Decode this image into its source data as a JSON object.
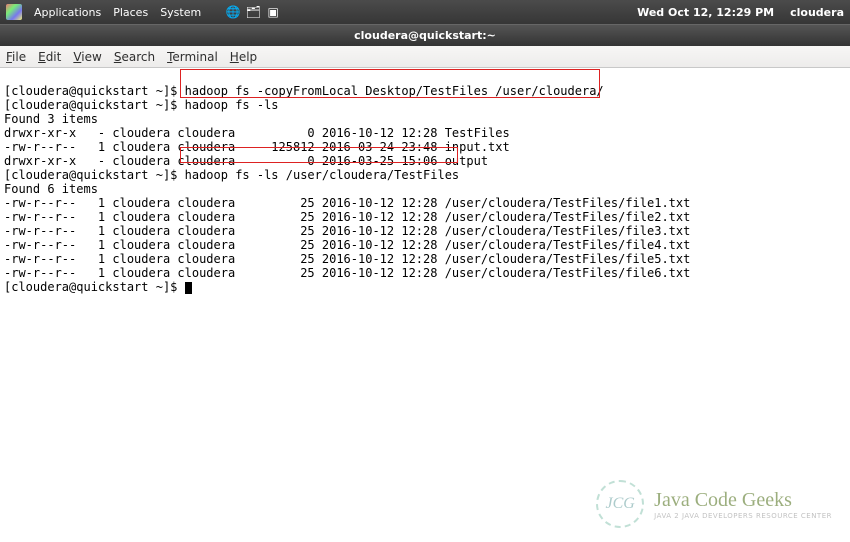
{
  "panel": {
    "menus": [
      "Applications",
      "Places",
      "System"
    ],
    "clock": "Wed Oct 12, 12:29 PM",
    "user": "cloudera"
  },
  "window": {
    "title": "cloudera@quickstart:~"
  },
  "menubar": {
    "file": "File",
    "edit": "Edit",
    "view": "View",
    "search": "Search",
    "terminal": "Terminal",
    "help": "Help"
  },
  "prompt": "[cloudera@quickstart ~]$ ",
  "lines": {
    "l0": "[cloudera@quickstart ~]$ hadoop fs -copyFromLocal Desktop/TestFiles /user/cloudera/",
    "l1": "[cloudera@quickstart ~]$ hadoop fs -ls",
    "l2": "Found 3 items",
    "l3": "drwxr-xr-x   - cloudera cloudera          0 2016-10-12 12:28 TestFiles",
    "l4": "-rw-r--r--   1 cloudera cloudera     125812 2016-03-24 23:48 input.txt",
    "l5": "drwxr-xr-x   - cloudera cloudera          0 2016-03-25 15:06 output",
    "l6": "[cloudera@quickstart ~]$ hadoop fs -ls /user/cloudera/TestFiles",
    "l7": "Found 6 items",
    "l8": "-rw-r--r--   1 cloudera cloudera         25 2016-10-12 12:28 /user/cloudera/TestFiles/file1.txt",
    "l9": "-rw-r--r--   1 cloudera cloudera         25 2016-10-12 12:28 /user/cloudera/TestFiles/file2.txt",
    "l10": "-rw-r--r--   1 cloudera cloudera         25 2016-10-12 12:28 /user/cloudera/TestFiles/file3.txt",
    "l11": "-rw-r--r--   1 cloudera cloudera         25 2016-10-12 12:28 /user/cloudera/TestFiles/file4.txt",
    "l12": "-rw-r--r--   1 cloudera cloudera         25 2016-10-12 12:28 /user/cloudera/TestFiles/file5.txt",
    "l13": "-rw-r--r--   1 cloudera cloudera         25 2016-10-12 12:28 /user/cloudera/TestFiles/file6.txt",
    "l14": "[cloudera@quickstart ~]$ "
  },
  "watermark": {
    "logo": "JCG",
    "title": "Java Code Geeks",
    "subtitle": "Java 2 Java Developers Resource Center"
  }
}
